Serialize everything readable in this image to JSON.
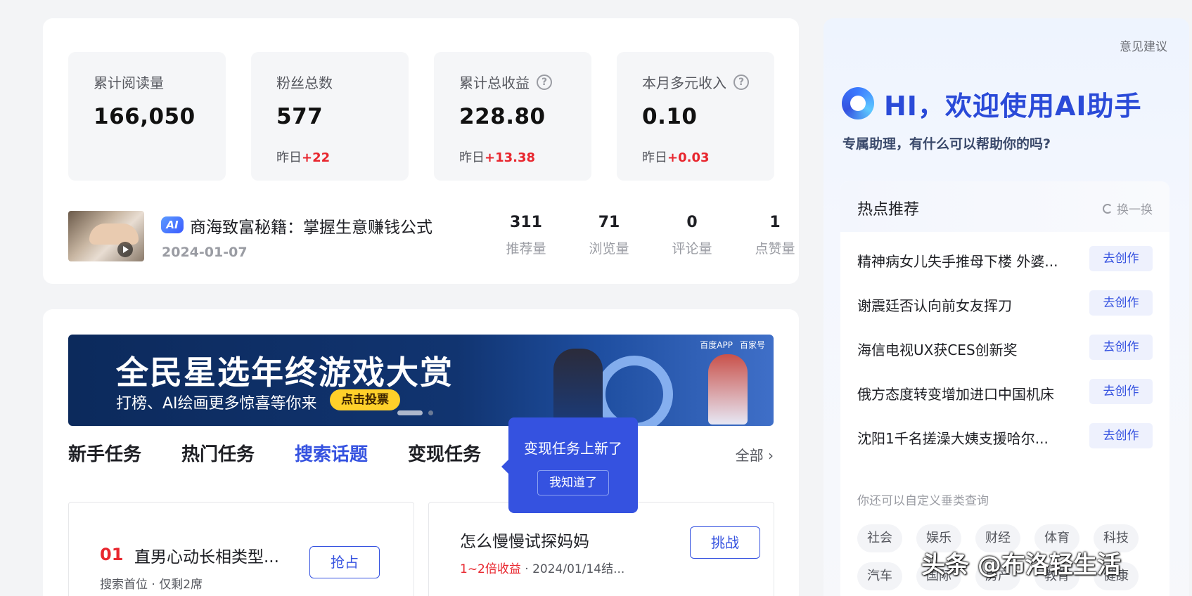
{
  "stats": [
    {
      "label": "累计阅读量",
      "value": "166,050",
      "delta_prefix": "",
      "delta": "",
      "help": false
    },
    {
      "label": "粉丝总数",
      "value": "577",
      "delta_prefix": "昨日",
      "delta": "+22",
      "help": false
    },
    {
      "label": "累计总收益",
      "value": "228.80",
      "delta_prefix": "昨日",
      "delta": "+13.38",
      "help": true
    },
    {
      "label": "本月多元收入",
      "value": "0.10",
      "delta_prefix": "昨日",
      "delta": "+0.03",
      "help": true
    }
  ],
  "article": {
    "badge": "AI",
    "title": "商海致富秘籍：掌握生意赚钱公式",
    "date": "2024-01-07",
    "metrics": [
      {
        "value": "311",
        "label": "推荐量"
      },
      {
        "value": "71",
        "label": "浏览量"
      },
      {
        "value": "0",
        "label": "评论量"
      },
      {
        "value": "1",
        "label": "点赞量"
      }
    ]
  },
  "banner": {
    "title": "全民星选年终游戏大赏",
    "subtitle": "打榜、AI绘画更多惊喜等你来",
    "button": "点击投票",
    "logo1": "百度APP",
    "logo2": "百家号"
  },
  "tabs": [
    "新手任务",
    "热门任务",
    "搜索话题",
    "变现任务"
  ],
  "active_tab": "搜索话题",
  "all_link": "全部",
  "tooltip": {
    "text": "变现任务上新了",
    "button": "我知道了"
  },
  "tasks": {
    "left": {
      "num": "01",
      "title": "直男心动长相类型...",
      "meta": "搜索首位 · 仅剩2席",
      "button": "抢占"
    },
    "right": {
      "title": "怎么慢慢试探妈妈",
      "meta_red": "1~2倍收益",
      "meta": " · 2024/01/14结...",
      "button": "挑战"
    }
  },
  "ai_panel": {
    "feedback": "意见建议",
    "title": "HI，欢迎使用AI助手",
    "subtitle": "专属助理，有什么可以帮助你的吗?",
    "hot_title": "热点推荐",
    "refresh": "换一换",
    "hot_items": [
      "精神病女儿失手推母下楼 外婆...",
      "谢震廷否认向前女友挥刀",
      "海信电视UX获CES创新奖",
      "俄方态度转变增加进口中国机床",
      "沈阳1千名搓澡大姨支援哈尔..."
    ],
    "create_label": "去创作",
    "custom_hint": "你还可以自定义垂类查询",
    "tags_row1": [
      "社会",
      "娱乐",
      "财经",
      "体育",
      "科技"
    ],
    "tags_row2": [
      "汽车",
      "国际",
      "房产",
      "教育",
      "健康"
    ]
  },
  "watermark": "头条 @布洛轻生活",
  "colors": {
    "accent": "#3552e0",
    "up": "#e8262e",
    "banner_btn": "#ffd02a"
  }
}
